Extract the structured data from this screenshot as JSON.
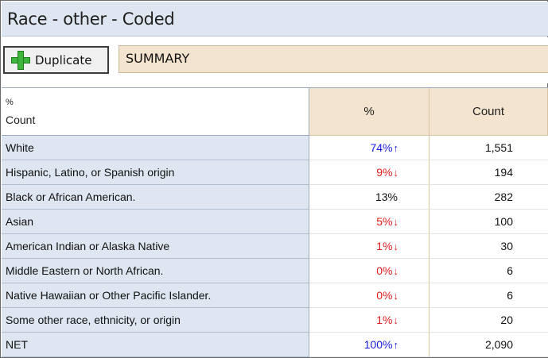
{
  "window": {
    "title": "Race - other - Coded"
  },
  "toolbar": {
    "duplicate_label": "Duplicate",
    "summary_label": "SUMMARY"
  },
  "table": {
    "corner": {
      "line1": "%",
      "line2": "Count"
    },
    "columns": [
      "%",
      "Count"
    ],
    "rows": [
      {
        "label": "White",
        "pct": "74%",
        "trend": "up",
        "arrow": "↑",
        "count": "1,551"
      },
      {
        "label": "Hispanic, Latino, or Spanish origin",
        "pct": "9%",
        "trend": "down",
        "arrow": "↓",
        "count": "194"
      },
      {
        "label": "Black or African American.",
        "pct": "13%",
        "trend": "neutral",
        "arrow": "",
        "count": "282"
      },
      {
        "label": "Asian",
        "pct": "5%",
        "trend": "down",
        "arrow": "↓",
        "count": "100"
      },
      {
        "label": "American Indian or Alaska Native",
        "pct": "1%",
        "trend": "down",
        "arrow": "↓",
        "count": "30"
      },
      {
        "label": "Middle Eastern or North African.",
        "pct": "0%",
        "trend": "down",
        "arrow": "↓",
        "count": "6"
      },
      {
        "label": "Native Hawaiian or Other Pacific Islander.",
        "pct": "0%",
        "trend": "down",
        "arrow": "↓",
        "count": "6"
      },
      {
        "label": "Some other race, ethnicity, or origin",
        "pct": "1%",
        "trend": "down",
        "arrow": "↓",
        "count": "20"
      },
      {
        "label": "NET",
        "pct": "100%",
        "trend": "up",
        "arrow": "↑",
        "count": "2,090"
      }
    ]
  },
  "colors": {
    "up": "#1a1ae0",
    "down": "#e01b1b",
    "label_bg": "#dde6f1",
    "header_bg": "#f3e4cf"
  },
  "icons": {
    "duplicate": "plus-icon"
  }
}
